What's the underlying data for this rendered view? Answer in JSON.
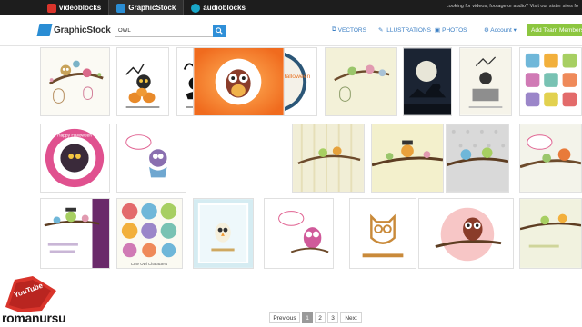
{
  "topbar": {
    "brands": [
      {
        "label": "videoblocks",
        "icon": "videoblocks-logo-icon"
      },
      {
        "label": "GraphicStock",
        "icon": "graphicstock-logo-icon"
      },
      {
        "label": "audioblocks",
        "icon": "audioblocks-logo-icon"
      }
    ],
    "note": "Looking for videos, footage or audio? Visit our sister sites fo"
  },
  "header": {
    "logo": "GraphicStock",
    "search_value": "OWL",
    "nav": [
      {
        "label": "VECTORS",
        "icon": "vectors-icon"
      },
      {
        "label": "ILLUSTRATIONS",
        "icon": "illustrations-icon"
      },
      {
        "label": "PHOTOS",
        "icon": "photos-icon"
      }
    ],
    "account": "Account",
    "add_team": "Add Team Members"
  },
  "thumbnails": [
    {
      "desc": "owls on tree branch with birdcages"
    },
    {
      "desc": "halloween owl on pumpkins"
    },
    {
      "desc": "halloween owls silhouette"
    },
    {
      "desc": "Happy Halloween owl circle",
      "text": "Happy Halloween"
    },
    {
      "desc": "owls on branch with birdcage"
    },
    {
      "desc": "halloween owl night moon"
    },
    {
      "desc": "halloween owl on grave"
    },
    {
      "desc": "owl icon set"
    },
    {
      "desc": "Happy Halloween circle badge",
      "text": "Happy Halloween"
    },
    {
      "desc": "owl with speech bubble"
    },
    {
      "desc": "owl on orange background"
    },
    {
      "desc": "owls on branch striped"
    },
    {
      "desc": "owls on branch yellow"
    },
    {
      "desc": "owls on branch dotted"
    },
    {
      "desc": "owls on branch green"
    },
    {
      "desc": "owls on branch purple"
    },
    {
      "desc": "Cute Owl Characters",
      "text": "Cute Owl Characters"
    },
    {
      "desc": "owl winter card"
    },
    {
      "desc": "owl with speech bubble pink"
    },
    {
      "desc": "outline owl logo"
    },
    {
      "desc": "owl on branch pink circle"
    },
    {
      "desc": "owls on branch green 2"
    }
  ],
  "pagination": {
    "prev": "Previous",
    "pages": [
      "1",
      "2",
      "3"
    ],
    "current": "1",
    "next": "Next"
  },
  "watermark": {
    "badge": "YouTube",
    "text": "romanursu"
  },
  "colors": {
    "topbar": "#1d1d1d",
    "accent_blue": "#2f8fd8",
    "add_team": "#8cc63f",
    "link": "#3b7fc4"
  }
}
